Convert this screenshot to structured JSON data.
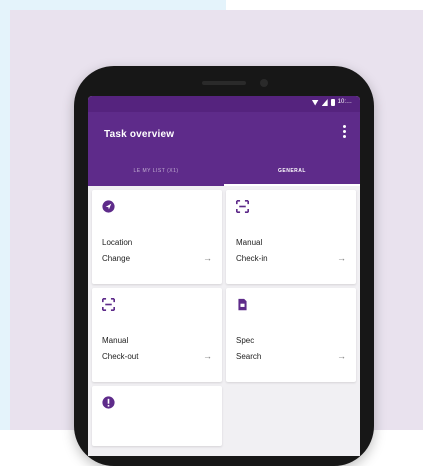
{
  "app": {
    "title": "Task overview",
    "status_time": "10:…"
  },
  "tabs": [
    {
      "label": "LE MY LIST (X1)",
      "active": false
    },
    {
      "label": "GENERAL",
      "active": true
    }
  ],
  "cards": [
    {
      "line1": "Location",
      "line2": "Change",
      "icon": "location-arrow-icon",
      "arrow": "→"
    },
    {
      "line1": "Manual",
      "line2": "Check-in",
      "icon": "scan-icon",
      "arrow": "→"
    },
    {
      "line1": "Manual",
      "line2": "Check-out",
      "icon": "scan-icon",
      "arrow": "→"
    },
    {
      "line1": "Spec",
      "line2": "Search",
      "icon": "document-icon",
      "arrow": "→"
    },
    {
      "line1": "",
      "line2": "",
      "icon": "alert-icon",
      "arrow": ""
    }
  ],
  "colors": {
    "primary": "#5e2b8a",
    "statusbar": "#55237e",
    "background": "#e9e2ee"
  }
}
